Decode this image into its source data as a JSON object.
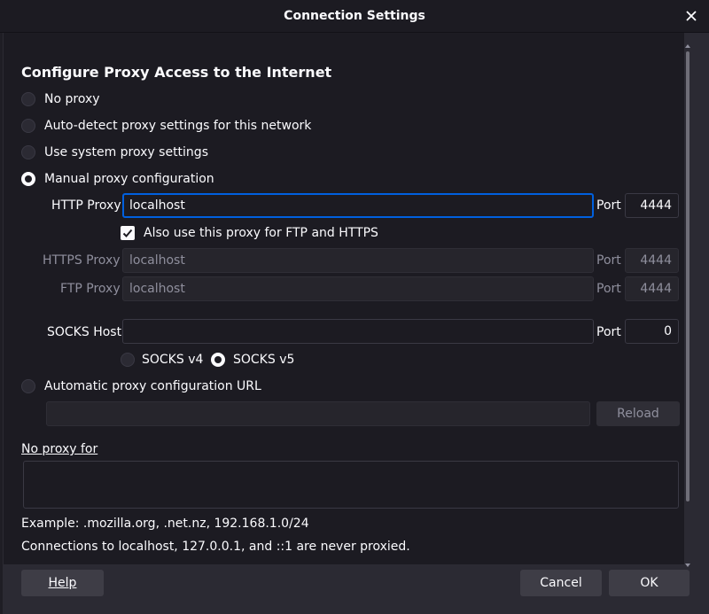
{
  "window": {
    "title": "Connection Settings"
  },
  "heading": "Configure Proxy Access to the Internet",
  "proxy_modes": [
    {
      "label": "No proxy",
      "selected": false
    },
    {
      "label": "Auto-detect proxy settings for this network",
      "selected": false
    },
    {
      "label": "Use system proxy settings",
      "selected": false
    },
    {
      "label": "Manual proxy configuration",
      "selected": true
    }
  ],
  "http": {
    "label": "HTTP Proxy",
    "value": "localhost",
    "port_label": "Port",
    "port": "4444"
  },
  "also_use": {
    "label": "Also use this proxy for FTP and HTTPS",
    "checked": true
  },
  "https": {
    "label": "HTTPS Proxy",
    "value": "localhost",
    "port_label": "Port",
    "port": "4444"
  },
  "ftp": {
    "label": "FTP Proxy",
    "value": "localhost",
    "port_label": "Port",
    "port": "4444"
  },
  "socks": {
    "label": "SOCKS Host",
    "value": "",
    "port_label": "Port",
    "port": "0",
    "v4_label": "SOCKS v4",
    "v5_label": "SOCKS v5",
    "selected": "v5"
  },
  "auto_config": {
    "label": "Automatic proxy configuration URL",
    "value": "",
    "reload_label": "Reload"
  },
  "no_proxy": {
    "label": "No proxy for",
    "value": ""
  },
  "example_text": "Example: .mozilla.org, .net.nz, 192.168.1.0/24",
  "localhost_note": "Connections to localhost, 127.0.0.1, and ::1 are never proxied.",
  "buttons": {
    "help": "Help",
    "cancel": "Cancel",
    "ok": "OK"
  },
  "colors": {
    "accent": "#0060df",
    "background": "#1c1b22",
    "text": "#fbfbfe"
  }
}
